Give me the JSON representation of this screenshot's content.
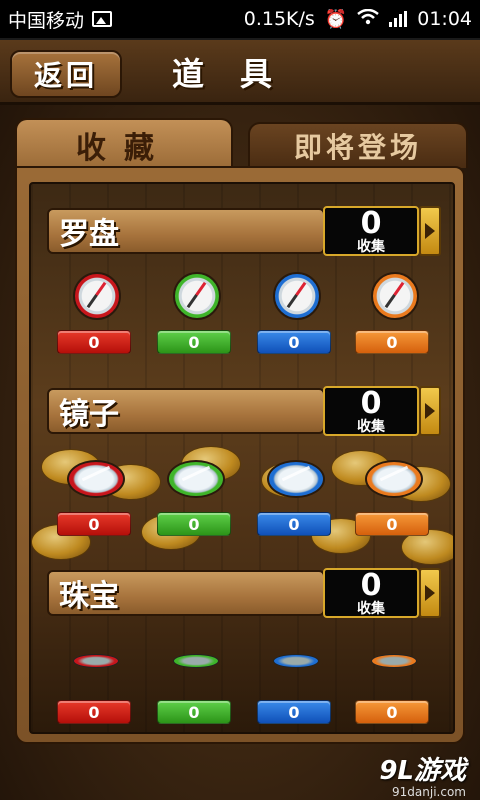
{
  "status_bar": {
    "carrier": "中国移动",
    "speed": "0.15K/s",
    "time": "01:04",
    "icons": [
      "image-icon",
      "alarm-icon",
      "wifi-icon",
      "signal-icon"
    ]
  },
  "header": {
    "back_label": "返回",
    "title": "道具"
  },
  "tabs": [
    {
      "label": "收藏",
      "active": true
    },
    {
      "label": "即将登场",
      "active": false
    }
  ],
  "sections": [
    {
      "name": "罗盘",
      "count": "0",
      "count_label": "收集",
      "item_type": "compass",
      "items": [
        {
          "color": "red",
          "value": "0"
        },
        {
          "color": "green",
          "value": "0"
        },
        {
          "color": "blue",
          "value": "0"
        },
        {
          "color": "orange",
          "value": "0"
        }
      ]
    },
    {
      "name": "镜子",
      "count": "0",
      "count_label": "收集",
      "item_type": "mirror",
      "items": [
        {
          "color": "red",
          "value": "0"
        },
        {
          "color": "green",
          "value": "0"
        },
        {
          "color": "blue",
          "value": "0"
        },
        {
          "color": "orange",
          "value": "0"
        }
      ]
    },
    {
      "name": "珠宝",
      "count": "0",
      "count_label": "收集",
      "item_type": "jewel",
      "items": [
        {
          "color": "red",
          "value": "0"
        },
        {
          "color": "green",
          "value": "0"
        },
        {
          "color": "blue",
          "value": "0"
        },
        {
          "color": "orange",
          "value": "0"
        }
      ]
    }
  ],
  "colors": {
    "red": "#c8161c",
    "green": "#3fb52a",
    "blue": "#1e6ed2",
    "orange": "#ea7a1e",
    "wood": "#a7733c",
    "gold_border": "#d8a82a"
  },
  "watermark": {
    "main": "9L游戏",
    "sub": "91danji.com"
  }
}
